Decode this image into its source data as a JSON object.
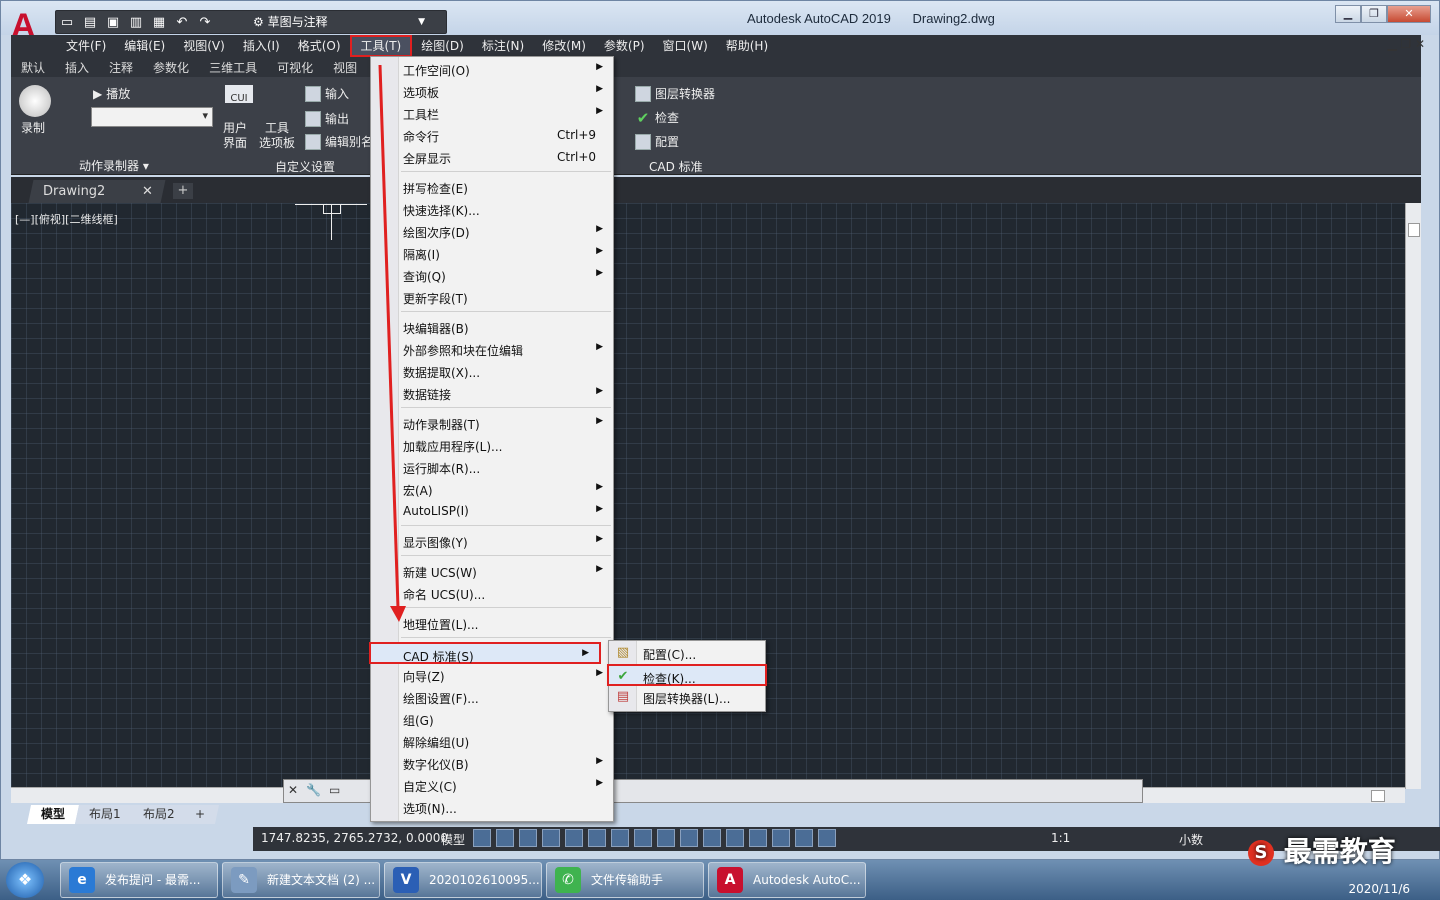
{
  "window": {
    "title": "Autodesk AutoCAD 2019",
    "filename": "Drawing2.dwg",
    "workspace": "草图与注释",
    "app_logo": "A",
    "controls": [
      "▁",
      "❐",
      "✕"
    ],
    "mdi_controls": "▁ ❐ ✕"
  },
  "menubar": [
    "文件(F)",
    "编辑(E)",
    "视图(V)",
    "插入(I)",
    "格式(O)",
    "工具(T)",
    "绘图(D)",
    "标注(N)",
    "修改(M)",
    "参数(P)",
    "窗口(W)",
    "帮助(H)"
  ],
  "ribbon_tabs": [
    "默认",
    "插入",
    "注释",
    "参数化",
    "三维工具",
    "可视化",
    "视图"
  ],
  "ribbon": {
    "record": "录制",
    "play": "播放",
    "action_recorder": "动作录制器 ▾",
    "user_interface": "用户\n界面",
    "tool_palettes": "工具\n选项板",
    "cui": "CUI",
    "import": "输入",
    "export": "输出",
    "edit_alias": "编辑别名",
    "customize": "自定义设置",
    "layer_translator": "图层转换器",
    "check": "检查",
    "configure": "配置",
    "cad_standards": "CAD 标准"
  },
  "file_tabs": {
    "active": "Drawing2",
    "close": "✕",
    "add": "+"
  },
  "viewport_label": "[—][俯视][二维线框]",
  "layout_tabs": [
    "模型",
    "布局1",
    "布局2",
    "+"
  ],
  "status": {
    "coords": "1747.8235, 2765.2732, 0.0000",
    "model": "模型",
    "scale": "1:1",
    "units": "小数"
  },
  "tools_menu": [
    {
      "label": "工作空间(O)",
      "sub": true
    },
    {
      "label": "选项板",
      "sub": true
    },
    {
      "label": "工具栏",
      "sub": true
    },
    {
      "label": "命令行",
      "shortcut": "Ctrl+9"
    },
    {
      "label": "全屏显示",
      "shortcut": "Ctrl+0"
    },
    {
      "sep": true
    },
    {
      "label": "拼写检查(E)"
    },
    {
      "label": "快速选择(K)..."
    },
    {
      "label": "绘图次序(D)",
      "sub": true
    },
    {
      "label": "隔离(I)",
      "sub": true
    },
    {
      "label": "查询(Q)",
      "sub": true
    },
    {
      "label": "更新字段(T)"
    },
    {
      "sep": true
    },
    {
      "label": "块编辑器(B)"
    },
    {
      "label": "外部参照和块在位编辑",
      "sub": true
    },
    {
      "label": "数据提取(X)..."
    },
    {
      "label": "数据链接",
      "sub": true
    },
    {
      "sep": true
    },
    {
      "label": "动作录制器(T)",
      "sub": true
    },
    {
      "label": "加载应用程序(L)..."
    },
    {
      "label": "运行脚本(R)..."
    },
    {
      "label": "宏(A)",
      "sub": true
    },
    {
      "label": "AutoLISP(I)",
      "sub": true
    },
    {
      "sep": true
    },
    {
      "label": "显示图像(Y)",
      "sub": true
    },
    {
      "sep": true
    },
    {
      "label": "新建 UCS(W)",
      "sub": true
    },
    {
      "label": "命名 UCS(U)..."
    },
    {
      "sep": true
    },
    {
      "label": "地理位置(L)..."
    },
    {
      "sep": true
    },
    {
      "label": "CAD 标准(S)",
      "sub": true,
      "highlight": true
    },
    {
      "label": "向导(Z)",
      "sub": true
    },
    {
      "label": "绘图设置(F)..."
    },
    {
      "label": "组(G)"
    },
    {
      "label": "解除编组(U)"
    },
    {
      "label": "数字化仪(B)",
      "sub": true
    },
    {
      "label": "自定义(C)",
      "sub": true
    },
    {
      "label": "选项(N)..."
    }
  ],
  "cad_standards_submenu": [
    {
      "label": "配置(C)..."
    },
    {
      "label": "检查(K)...",
      "highlight": true
    },
    {
      "label": "图层转换器(L)..."
    }
  ],
  "taskbar": [
    {
      "label": "发布提问 - 最需...",
      "icon": "e",
      "color": "#2a7ad5"
    },
    {
      "label": "新建文本文档 (2) ...",
      "icon": "✎",
      "color": "#7c9bc0"
    },
    {
      "label": "2020102610095...",
      "icon": "V",
      "color": "#2b5fb5"
    },
    {
      "label": "文件传输助手",
      "icon": "✆",
      "color": "#3fb34f"
    },
    {
      "label": "Autodesk AutoC...",
      "icon": "A",
      "color": "#c8102e"
    }
  ],
  "tray": {
    "date": "2020/11/6"
  },
  "watermark": {
    "logo": "S",
    "text": "最需教育"
  }
}
